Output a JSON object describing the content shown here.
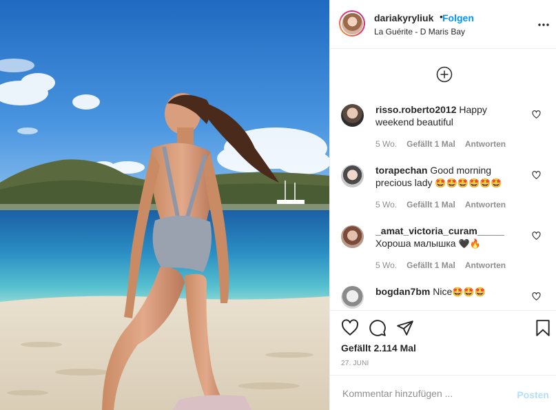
{
  "post": {
    "username": "dariakyryliuk",
    "separator": "•",
    "follow_label": "Folgen",
    "location": "La Guérite - D Maris Bay",
    "more_icon": "more-horizontal-icon",
    "image_alt": "Woman in swimsuit on a sandy beach by the sea"
  },
  "comments": [
    {
      "user": "risso.roberto2012",
      "text": "Happy weekend beautiful",
      "emojis": "",
      "time": "5 Wo.",
      "likes": "Gefällt 1 Mal",
      "reply": "Antworten"
    },
    {
      "user": "torapechan",
      "text": "Good morning precious lady",
      "emojis": "🤩🤩🤩🤩🤩🤩",
      "time": "5 Wo.",
      "likes": "Gefällt 1 Mal",
      "reply": "Antworten"
    },
    {
      "user": "_amat_victoria_curam_____",
      "text": "Хороша малышка",
      "emojis": "🖤🔥",
      "time": "5 Wo.",
      "likes": "Gefällt 1 Mal",
      "reply": "Antworten"
    },
    {
      "user": "bogdan7bm",
      "text": "Nice",
      "emojis": "🤩🤩🤩",
      "time": "",
      "likes": "",
      "reply": ""
    }
  ],
  "actions": {
    "likes_text": "Gefällt 2.114 Mal",
    "date": "27. JUNI"
  },
  "composer": {
    "placeholder": "Kommentar hinzufügen ...",
    "post_label": "Posten"
  },
  "colors": {
    "accent": "#0095f6",
    "post_disabled": "#b2dffc",
    "muted": "#8e8e8e",
    "text": "#262626"
  }
}
